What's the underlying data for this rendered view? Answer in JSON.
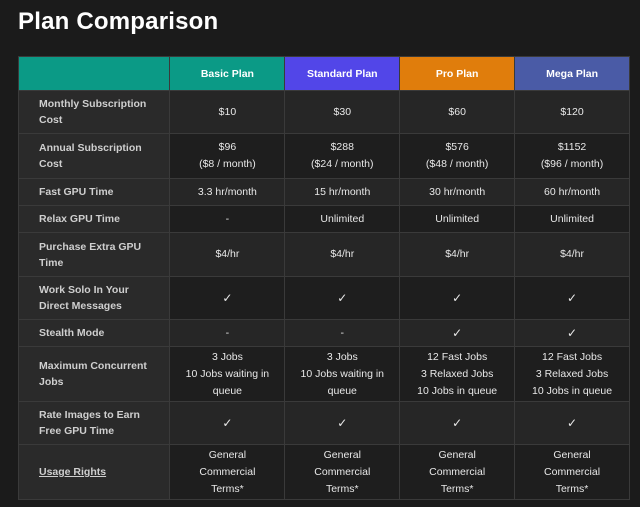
{
  "title": "Plan Comparison",
  "colors": {
    "label_header": "#0b9a86",
    "basic": "#0b9a86",
    "standard": "#5246e8",
    "pro": "#e07d0c",
    "mega": "#4a5ba6"
  },
  "plans": [
    "Basic Plan",
    "Standard Plan",
    "Pro Plan",
    "Mega Plan"
  ],
  "rows": [
    {
      "label": "Monthly Subscription Cost",
      "cells": [
        [
          "$10"
        ],
        [
          "$30"
        ],
        [
          "$60"
        ],
        [
          "$120"
        ]
      ]
    },
    {
      "label": "Annual Subscription Cost",
      "cells": [
        [
          "$96",
          "($8 / month)"
        ],
        [
          "$288",
          "($24 / month)"
        ],
        [
          "$576",
          "($48 / month)"
        ],
        [
          "$1152",
          "($96 / month)"
        ]
      ]
    },
    {
      "label": "Fast GPU Time",
      "cells": [
        [
          "3.3 hr/month"
        ],
        [
          "15 hr/month"
        ],
        [
          "30 hr/month"
        ],
        [
          "60 hr/month"
        ]
      ]
    },
    {
      "label": "Relax GPU Time",
      "cells": [
        [
          "-"
        ],
        [
          "Unlimited"
        ],
        [
          "Unlimited"
        ],
        [
          "Unlimited"
        ]
      ]
    },
    {
      "label": "Purchase Extra GPU Time",
      "cells": [
        [
          "$4/hr"
        ],
        [
          "$4/hr"
        ],
        [
          "$4/hr"
        ],
        [
          "$4/hr"
        ]
      ]
    },
    {
      "label": "Work Solo In Your Direct Messages",
      "cells": [
        [
          "✓"
        ],
        [
          "✓"
        ],
        [
          "✓"
        ],
        [
          "✓"
        ]
      ]
    },
    {
      "label": "Stealth Mode",
      "cells": [
        [
          "-"
        ],
        [
          "-"
        ],
        [
          "✓"
        ],
        [
          "✓"
        ]
      ]
    },
    {
      "label": "Maximum Concurrent Jobs",
      "cells": [
        [
          "3 Jobs",
          "10 Jobs waiting in",
          "queue"
        ],
        [
          "3 Jobs",
          "10 Jobs waiting in",
          "queue"
        ],
        [
          "12 Fast Jobs",
          "3 Relaxed Jobs",
          "10 Jobs in queue"
        ],
        [
          "12 Fast Jobs",
          "3 Relaxed Jobs",
          "10 Jobs in queue"
        ]
      ]
    },
    {
      "label": "Rate Images to Earn Free GPU Time",
      "cells": [
        [
          "✓"
        ],
        [
          "✓"
        ],
        [
          "✓"
        ],
        [
          "✓"
        ]
      ]
    },
    {
      "label": "Usage Rights",
      "link": true,
      "cells": [
        [
          "General",
          "Commercial",
          "Terms*"
        ],
        [
          "General",
          "Commercial",
          "Terms*"
        ],
        [
          "General",
          "Commercial",
          "Terms*"
        ],
        [
          "General",
          "Commercial",
          "Terms*"
        ]
      ]
    }
  ]
}
